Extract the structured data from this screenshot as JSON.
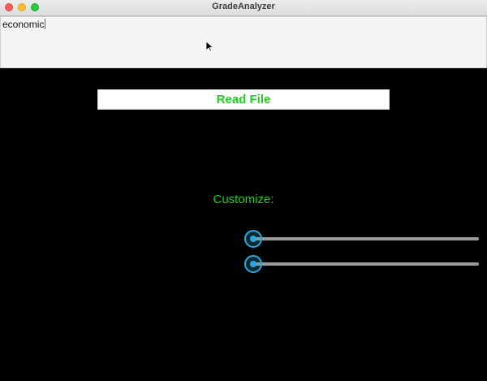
{
  "window": {
    "title": "GradeAnalyzer"
  },
  "text_area": {
    "value": "economic"
  },
  "read_button": {
    "label": "Read File"
  },
  "customize": {
    "label": "Customize:"
  },
  "sliders": [
    {
      "value": 0
    },
    {
      "value": 0
    }
  ],
  "colors": {
    "accent_green": "#22cc22",
    "slider_blue": "#2da8d8",
    "background": "#000000"
  },
  "icons": [
    "close-icon",
    "minimize-icon",
    "maximize-icon",
    "mouse-pointer-icon"
  ]
}
